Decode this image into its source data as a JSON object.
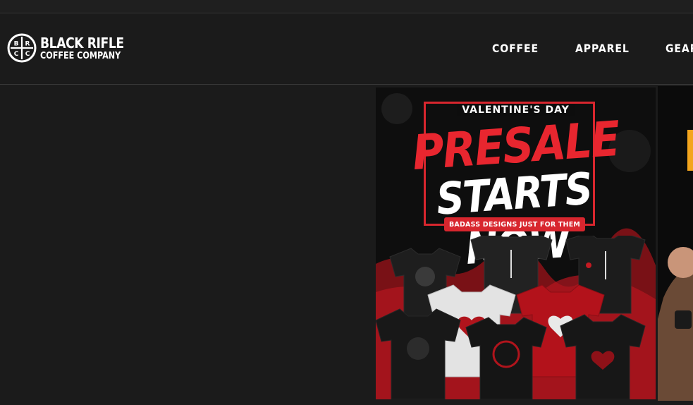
{
  "brand": {
    "line1": "BLACK RIFLE",
    "line2": "COFFEE COMPANY",
    "mark_letters": [
      "B",
      "R",
      "C",
      "C"
    ]
  },
  "nav": {
    "items": [
      {
        "label": "COFFEE"
      },
      {
        "label": "APPAREL"
      },
      {
        "label": "GEAR"
      }
    ]
  },
  "promo": {
    "eyebrow": "VALENTINE'S DAY",
    "headline": "PRESALE",
    "subheadline": "STARTS NOW",
    "tagline": "BADASS DESIGNS JUST FOR THEM"
  },
  "colors": {
    "background": "#1b1b1b",
    "accent_red": "#d8262e",
    "text": "#ffffff"
  }
}
